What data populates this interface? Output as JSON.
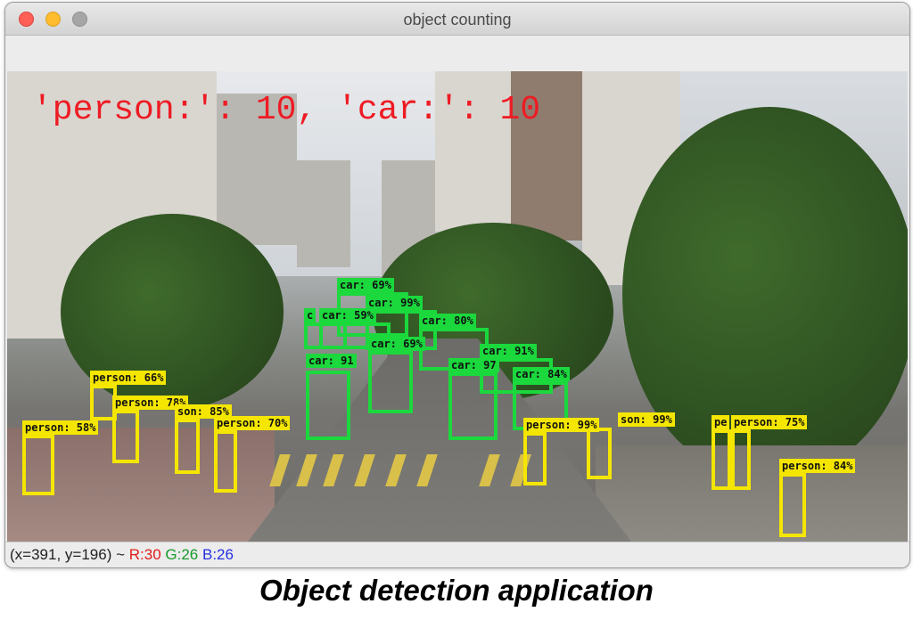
{
  "window": {
    "title": "object counting"
  },
  "overlay": {
    "count_text": "'person:': 10, 'car:': 10"
  },
  "detections": [
    {
      "cls": "car",
      "label": "car: 69%"
    },
    {
      "cls": "car",
      "label": "car: 99%"
    },
    {
      "cls": "car",
      "label": "c"
    },
    {
      "cls": "car",
      "label": "car: 59%"
    },
    {
      "cls": "car",
      "label": "car: 80%"
    },
    {
      "cls": "car",
      "label": "car: 69%"
    },
    {
      "cls": "car",
      "label": "car: 91%"
    },
    {
      "cls": "car",
      "label": "car: 91"
    },
    {
      "cls": "car",
      "label": "car: 97"
    },
    {
      "cls": "car",
      "label": "car: 84%"
    },
    {
      "cls": "person",
      "label": "person: 66%"
    },
    {
      "cls": "person",
      "label": "person: 78%"
    },
    {
      "cls": "person",
      "label": "person: 58%"
    },
    {
      "cls": "person",
      "label": "son: 85%"
    },
    {
      "cls": "person",
      "label": "person: 70%"
    },
    {
      "cls": "person",
      "label": "person: 99%"
    },
    {
      "cls": "person",
      "label": "son: 99%"
    },
    {
      "cls": "person",
      "label": "pe"
    },
    {
      "cls": "person",
      "label": "person: 75%"
    },
    {
      "cls": "person",
      "label": "person: 84%"
    }
  ],
  "status": {
    "coords": "(x=391, y=196) ~",
    "r": "R:30",
    "g": "G:26",
    "b": "B:26"
  },
  "caption": "Object detection application",
  "colors": {
    "car_box": "#1bd83d",
    "person_box": "#f4e600",
    "count_text": "#ee1b23"
  }
}
